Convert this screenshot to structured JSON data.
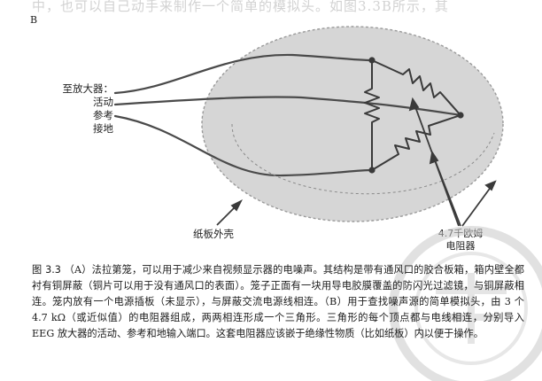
{
  "figure": {
    "panel_label": "B",
    "labels": {
      "to_amplifier": "至放大器：",
      "active": "活动",
      "reference": "参考",
      "ground": "接地",
      "board_shell": "纸板外壳",
      "resistor_line1": "4.7千欧姆",
      "resistor_line2": "电阻器"
    }
  },
  "caption": {
    "number": "图 3.3",
    "text": "（A）法拉第笼，可以用于减少来自视频显示器的电噪声。其结构是带有通风口的胶合板箱，箱内壁全都衬有铜屏蔽（铜片可以用于没有通风口的表面）。笼子正面有一块用导电胶膜覆盖的防闪光过滤镜，与铜屏蔽相连。笼内放有一个电源插板（未显示），与屏蔽交流电源线相连。（B）用于查找噪声源的简单模拟头，由 3 个 4.7 kΩ（或近似值）的电阻器组成，两两相连形成一个三角形。三角形的每个顶点都与电线相连，分别导入 EEG 放大器的活动、参考和地输入端口。这套电阻器应该嵌于绝缘性物质（比如纸板）内以便于操作。"
  },
  "colors": {
    "ellipse_fill": "#d6d6d6",
    "wire": "#4a4a4a",
    "text": "#1a1a1a"
  }
}
